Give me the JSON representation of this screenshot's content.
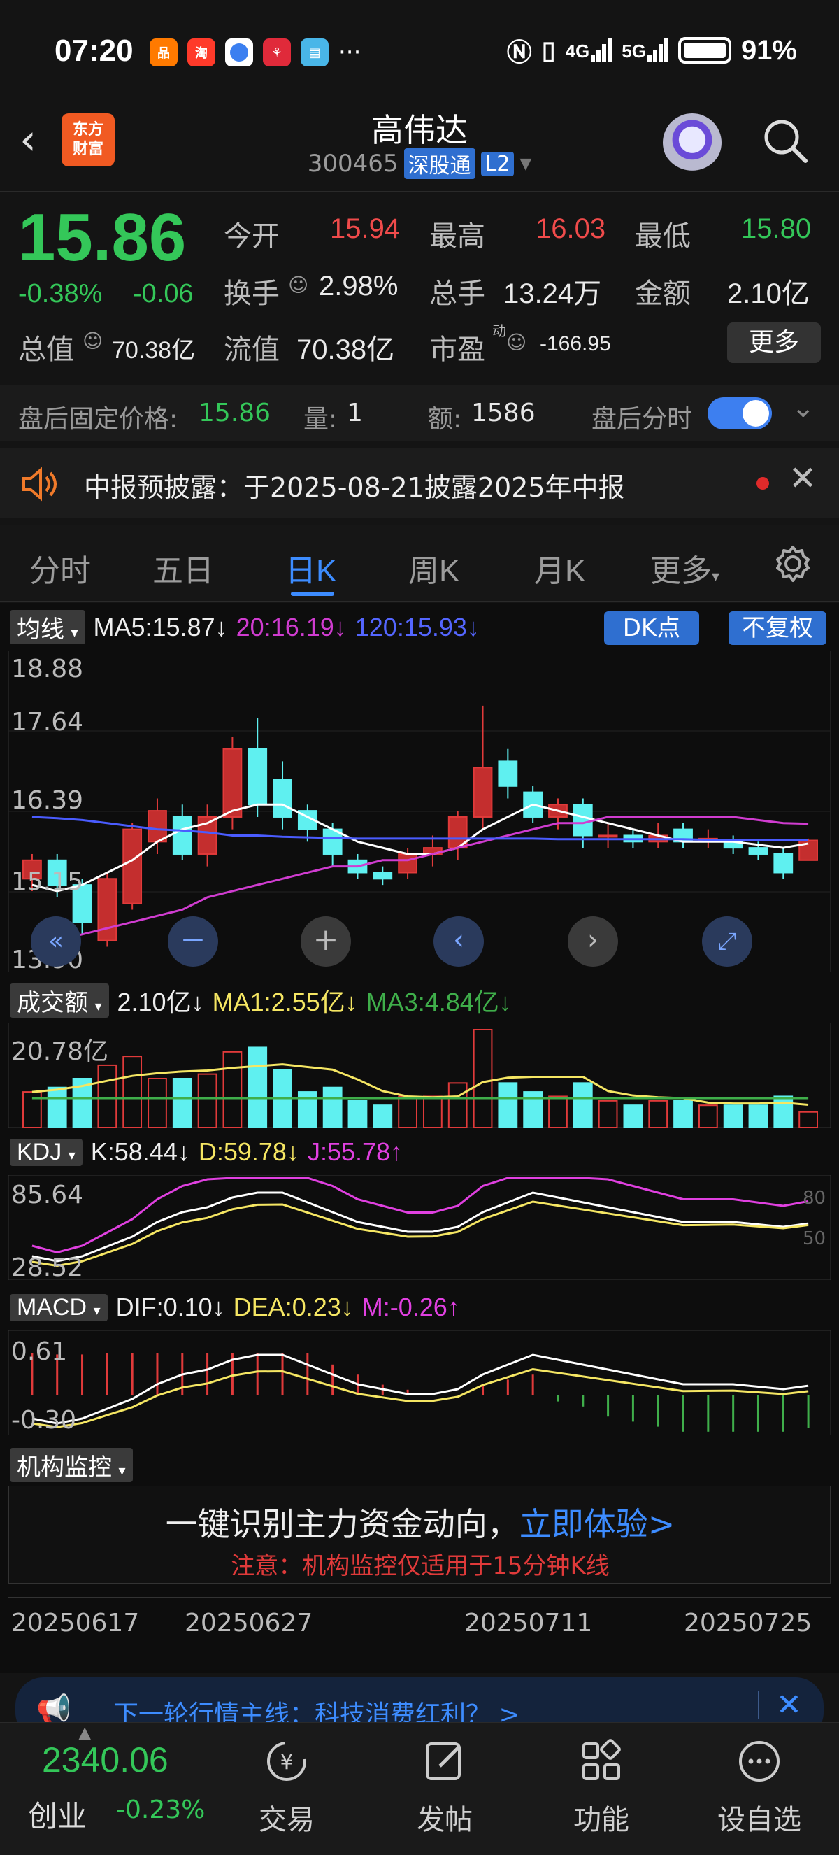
{
  "status": {
    "time": "07:20",
    "network": "4G",
    "network2": "5G",
    "battery": "91%",
    "more_dots": "···"
  },
  "header": {
    "app_logo_line1": "东方",
    "app_logo_line2": "财富",
    "stock_name": "高伟达",
    "stock_code": "300465",
    "exchange_tag": "深股通",
    "level_tag": "L2"
  },
  "quote": {
    "price": "15.86",
    "change_pct": "-0.38%",
    "change_abs": "-0.06",
    "open_label": "今开",
    "open": "15.94",
    "high_label": "最高",
    "high": "16.03",
    "low_label": "最低",
    "low": "15.80",
    "turnover_label": "换手",
    "turnover": "2.98%",
    "volume_label": "总手",
    "volume": "13.24万",
    "amount_label": "金额",
    "amount": "2.10亿",
    "mktcap_label": "总值",
    "mktcap": "70.38亿",
    "float_label": "流值",
    "float": "70.38亿",
    "pe_label": "市盈",
    "pe_sup": "动",
    "pe": "-166.95",
    "more_button": "更多"
  },
  "after_hours": {
    "price_label": "盘后固定价格:",
    "price": "15.86",
    "vol_label": "量:",
    "vol": "1",
    "amt_label": "额:",
    "amt": "1586",
    "timeshare_label": "盘后分时",
    "toggle_on": true
  },
  "notice": {
    "text": "中报预披露：于2025-08-21披露2025年中报"
  },
  "tabs": [
    "分时",
    "五日",
    "日K",
    "周K",
    "月K",
    "更多"
  ],
  "active_tab": 2,
  "ma_row": {
    "label": "均线",
    "ma5": "MA5:15.87",
    "ma20": "20:16.19",
    "ma120": "120:15.93",
    "dk_button": "DK点",
    "fq_button": "不复权"
  },
  "price_axis": [
    "18.88",
    "17.64",
    "16.39",
    "15.15",
    "13.90"
  ],
  "volume_row": {
    "label": "成交额",
    "value": "2.10亿",
    "ma1": "MA1:2.55亿",
    "ma3": "MA3:4.84亿",
    "axis": "20.78亿"
  },
  "kdj_row": {
    "label": "KDJ",
    "k": "K:58.44",
    "d": "D:59.78",
    "j": "J:55.78",
    "axis_top": "85.64",
    "axis_bottom": "28.52",
    "right_80": "80",
    "right_50": "50"
  },
  "macd_row": {
    "label": "MACD",
    "dif": "DIF:0.10",
    "dea": "DEA:0.23",
    "m": "M:-0.26",
    "axis_top": "0.61",
    "axis_bottom": "-0.30"
  },
  "inst_row": {
    "label": "机构监控",
    "main_text": "一键识别主力资金动向，",
    "link_text": "立即体验>",
    "note": "注意：机构监控仅适用于15分钟K线"
  },
  "dates": [
    "20250617",
    "20250627",
    "20250711",
    "20250725"
  ],
  "promo": {
    "text": "下一轮行情主线：科技消费红利？ >"
  },
  "bottom_nav": {
    "index_value": "2340.06",
    "index_name": "创业",
    "index_change": "-0.23%",
    "items": [
      "交易",
      "发帖",
      "功能",
      "设自选"
    ]
  },
  "chart_data": {
    "type": "candlestick",
    "dates_shown": [
      "20250617",
      "20250627",
      "20250711",
      "20250725"
    ],
    "ylim": [
      13.9,
      18.88
    ],
    "candles": [
      {
        "o": 15.3,
        "c": 15.6,
        "h": 15.7,
        "l": 15.1
      },
      {
        "o": 15.6,
        "c": 15.2,
        "h": 15.7,
        "l": 15.0
      },
      {
        "o": 15.2,
        "c": 14.6,
        "h": 15.3,
        "l": 14.4
      },
      {
        "o": 14.3,
        "c": 15.3,
        "h": 15.4,
        "l": 14.2
      },
      {
        "o": 14.9,
        "c": 16.1,
        "h": 16.2,
        "l": 14.8
      },
      {
        "o": 15.9,
        "c": 16.4,
        "h": 16.6,
        "l": 15.7
      },
      {
        "o": 16.3,
        "c": 15.7,
        "h": 16.5,
        "l": 15.6
      },
      {
        "o": 15.7,
        "c": 16.3,
        "h": 16.5,
        "l": 15.5
      },
      {
        "o": 16.3,
        "c": 17.4,
        "h": 17.6,
        "l": 16.1
      },
      {
        "o": 17.4,
        "c": 16.5,
        "h": 17.9,
        "l": 16.3
      },
      {
        "o": 16.9,
        "c": 16.3,
        "h": 17.2,
        "l": 16.1
      },
      {
        "o": 16.4,
        "c": 16.1,
        "h": 16.5,
        "l": 15.9
      },
      {
        "o": 16.1,
        "c": 15.7,
        "h": 16.2,
        "l": 15.5
      },
      {
        "o": 15.6,
        "c": 15.4,
        "h": 15.7,
        "l": 15.3
      },
      {
        "o": 15.4,
        "c": 15.3,
        "h": 15.5,
        "l": 15.2
      },
      {
        "o": 15.4,
        "c": 15.7,
        "h": 15.8,
        "l": 15.3
      },
      {
        "o": 15.7,
        "c": 15.8,
        "h": 16.0,
        "l": 15.5
      },
      {
        "o": 15.8,
        "c": 16.3,
        "h": 16.4,
        "l": 15.6
      },
      {
        "o": 16.3,
        "c": 17.1,
        "h": 18.1,
        "l": 16.1
      },
      {
        "o": 17.2,
        "c": 16.8,
        "h": 17.4,
        "l": 16.6
      },
      {
        "o": 16.7,
        "c": 16.3,
        "h": 16.8,
        "l": 16.2
      },
      {
        "o": 16.3,
        "c": 16.5,
        "h": 16.6,
        "l": 16.1
      },
      {
        "o": 16.5,
        "c": 16.0,
        "h": 16.6,
        "l": 15.8
      },
      {
        "o": 16.0,
        "c": 16.0,
        "h": 16.2,
        "l": 15.8
      },
      {
        "o": 16.0,
        "c": 15.9,
        "h": 16.1,
        "l": 15.8
      },
      {
        "o": 15.9,
        "c": 16.0,
        "h": 16.2,
        "l": 15.8
      },
      {
        "o": 16.1,
        "c": 15.9,
        "h": 16.2,
        "l": 15.8
      },
      {
        "o": 15.9,
        "c": 15.95,
        "h": 16.1,
        "l": 15.8
      },
      {
        "o": 15.9,
        "c": 15.8,
        "h": 16.0,
        "l": 15.7
      },
      {
        "o": 15.8,
        "c": 15.7,
        "h": 15.9,
        "l": 15.6
      },
      {
        "o": 15.7,
        "c": 15.4,
        "h": 15.8,
        "l": 15.3
      },
      {
        "o": 15.6,
        "c": 15.92,
        "h": 15.95,
        "l": 15.8
      }
    ],
    "series": [
      {
        "name": "MA5",
        "color": "#ffffff",
        "values": [
          15.2,
          15.1,
          15.2,
          15.4,
          15.6,
          15.9,
          16.1,
          16.2,
          16.4,
          16.5,
          16.5,
          16.3,
          16.1,
          15.9,
          15.8,
          15.7,
          15.7,
          15.8,
          16.1,
          16.3,
          16.5,
          16.4,
          16.3,
          16.2,
          16.1,
          16.0,
          15.9,
          15.9,
          15.9,
          15.85,
          15.8,
          15.87
        ]
      },
      {
        "name": "20",
        "color": "#d03cd0",
        "values": [
          14.2,
          14.3,
          14.4,
          14.5,
          14.6,
          14.7,
          14.8,
          15.0,
          15.1,
          15.2,
          15.3,
          15.4,
          15.5,
          15.5,
          15.6,
          15.6,
          15.7,
          15.8,
          15.9,
          16.0,
          16.1,
          16.2,
          16.2,
          16.3,
          16.3,
          16.3,
          16.3,
          16.3,
          16.3,
          16.25,
          16.2,
          16.19
        ]
      },
      {
        "name": "120",
        "color": "#4a5cff",
        "values": [
          16.3,
          16.28,
          16.25,
          16.2,
          16.15,
          16.1,
          16.08,
          16.05,
          16.0,
          16.0,
          15.98,
          15.97,
          15.96,
          15.95,
          15.95,
          15.95,
          15.95,
          15.95,
          15.95,
          15.95,
          15.95,
          15.94,
          15.94,
          15.94,
          15.94,
          15.94,
          15.94,
          15.93,
          15.93,
          15.93,
          15.93,
          15.93
        ]
      }
    ]
  }
}
